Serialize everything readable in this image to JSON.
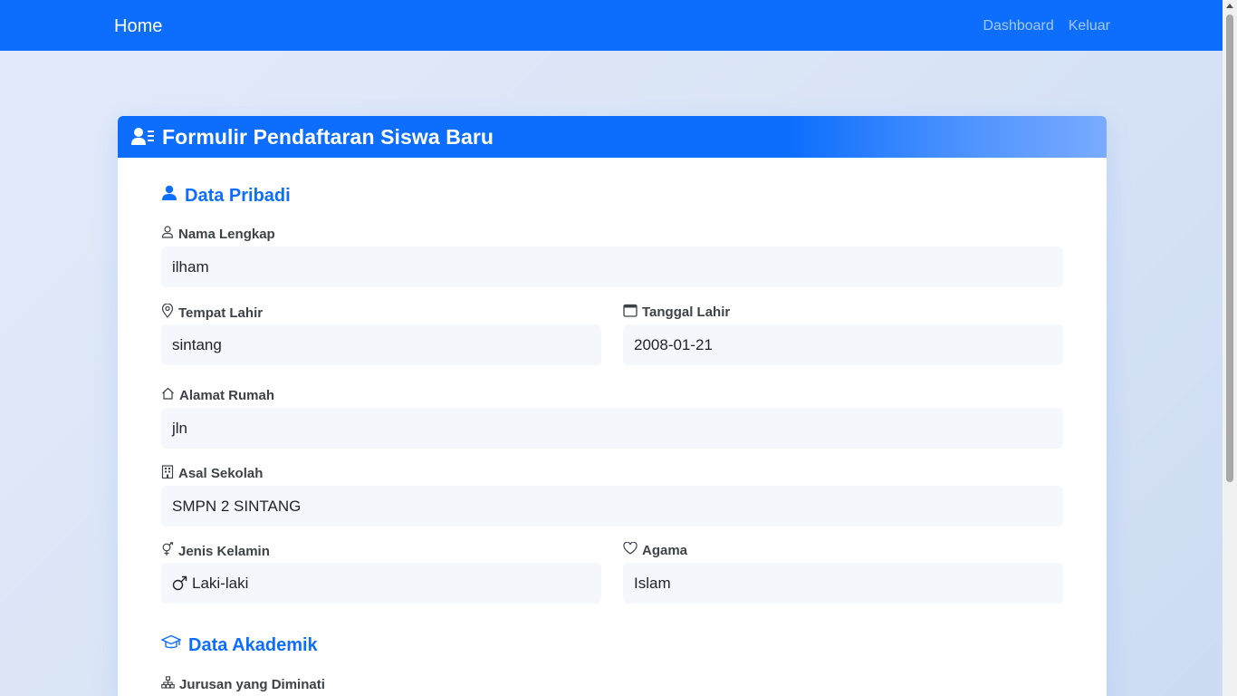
{
  "navbar": {
    "brand": "Home",
    "links": [
      "Dashboard",
      "Keluar"
    ]
  },
  "form": {
    "title": "Formulir Pendaftaran Siswa Baru",
    "section_personal": "Data Pribadi",
    "section_academic": "Data Akademik",
    "fields": {
      "nama": {
        "label": "Nama Lengkap",
        "value": "ilham"
      },
      "tempat": {
        "label": "Tempat Lahir",
        "value": "sintang"
      },
      "tanggal": {
        "label": "Tanggal Lahir",
        "value": "2008-01-21"
      },
      "alamat": {
        "label": "Alamat Rumah",
        "value": "jln"
      },
      "sekolah": {
        "label": "Asal Sekolah",
        "value": "SMPN 2 SINTANG"
      },
      "kelamin": {
        "label": "Jenis Kelamin",
        "value": "Laki-laki"
      },
      "agama": {
        "label": "Agama",
        "value": "Islam"
      },
      "jurusan": {
        "label": "Jurusan yang Diminati"
      }
    }
  },
  "colors": {
    "primary": "#0d6efd",
    "field_bg": "#f4f7fc",
    "label": "#3d4248"
  }
}
